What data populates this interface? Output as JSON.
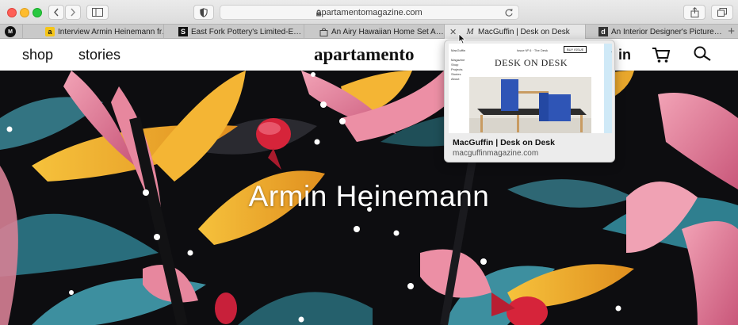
{
  "window": {
    "url": "apartamentomagazine.com"
  },
  "tabs": [
    {
      "title": "Interview Armin Heinemann fr…",
      "favicon": "a"
    },
    {
      "title": "East Fork Pottery's Limited-E…",
      "favicon": "S"
    },
    {
      "title": "An Airy Hawaiian Home Set A…",
      "favicon": "bag-icon"
    },
    {
      "title": "MacGuffin | Desk on Desk",
      "favicon": "M",
      "active": true
    },
    {
      "title": "An Interior Designer's Picture…",
      "favicon": "d"
    }
  ],
  "pinned_tab_label": "M",
  "site": {
    "nav": {
      "shop": "shop",
      "stories": "stories",
      "login": "in"
    },
    "logo": "apartamento",
    "hero_title": "Armin Heinemann"
  },
  "preview": {
    "brand": "MacGuffin",
    "issue": "Issue Nº 6 · The Desk",
    "buy": "BUY ISSUE",
    "menu": [
      "Magazine",
      "Shop",
      "Projects",
      "Stories",
      "About"
    ],
    "headline": "DESK ON DESK",
    "title": "MacGuffin | Desk on Desk",
    "url": "macguffinmagazine.com"
  },
  "colors": {
    "hero_bg": "#0d0d10",
    "petal_pink": "#ec8fa5",
    "leaf_yellow": "#f2b632",
    "leaf_teal": "#3d8f9f",
    "bird_red": "#d6243a"
  }
}
